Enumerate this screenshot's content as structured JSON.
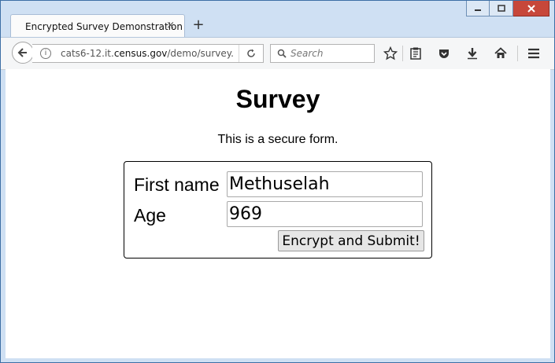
{
  "browser": {
    "tab_title": "Encrypted Survey Demonstration",
    "tab_close": "×",
    "new_tab": "+",
    "url_prefix": "cats6-12.it.",
    "url_domain": "census.gov",
    "url_suffix": "/demo/survey.c",
    "search_placeholder": "Search"
  },
  "page": {
    "title": "Survey",
    "subtitle": "This is a secure form."
  },
  "form": {
    "first_name_label": "First name",
    "first_name_value": "Methuselah",
    "age_label": "Age",
    "age_value": "969",
    "submit_label": "Encrypt and Submit!"
  },
  "colors": {
    "window_frame": "#cfe0f3",
    "close_button": "#c7473a",
    "desktop": "#6fa8dc"
  }
}
